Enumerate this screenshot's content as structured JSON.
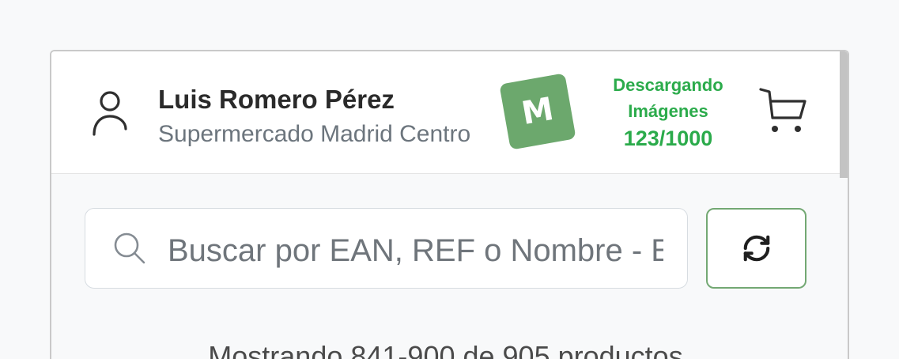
{
  "header": {
    "user": {
      "icon": "person-icon",
      "name": "Luis Romero Pérez",
      "store": "Supermercado Madrid Centro"
    },
    "logo": {
      "letter": "M",
      "color": "#6ca86d"
    },
    "download_status": {
      "label_line1": "Descargando",
      "label_line2": "Imágenes",
      "progress": "123/1000",
      "color": "#2bab4b"
    },
    "cart": {
      "icon": "cart-icon"
    }
  },
  "search": {
    "icon": "search-icon",
    "placeholder": "Buscar por EAN, REF o Nombre - E"
  },
  "refresh_button": {
    "icon": "refresh-icon",
    "border_color": "#73a873"
  },
  "results": {
    "summary": "Mostrando 841-900 de 905 productos"
  }
}
